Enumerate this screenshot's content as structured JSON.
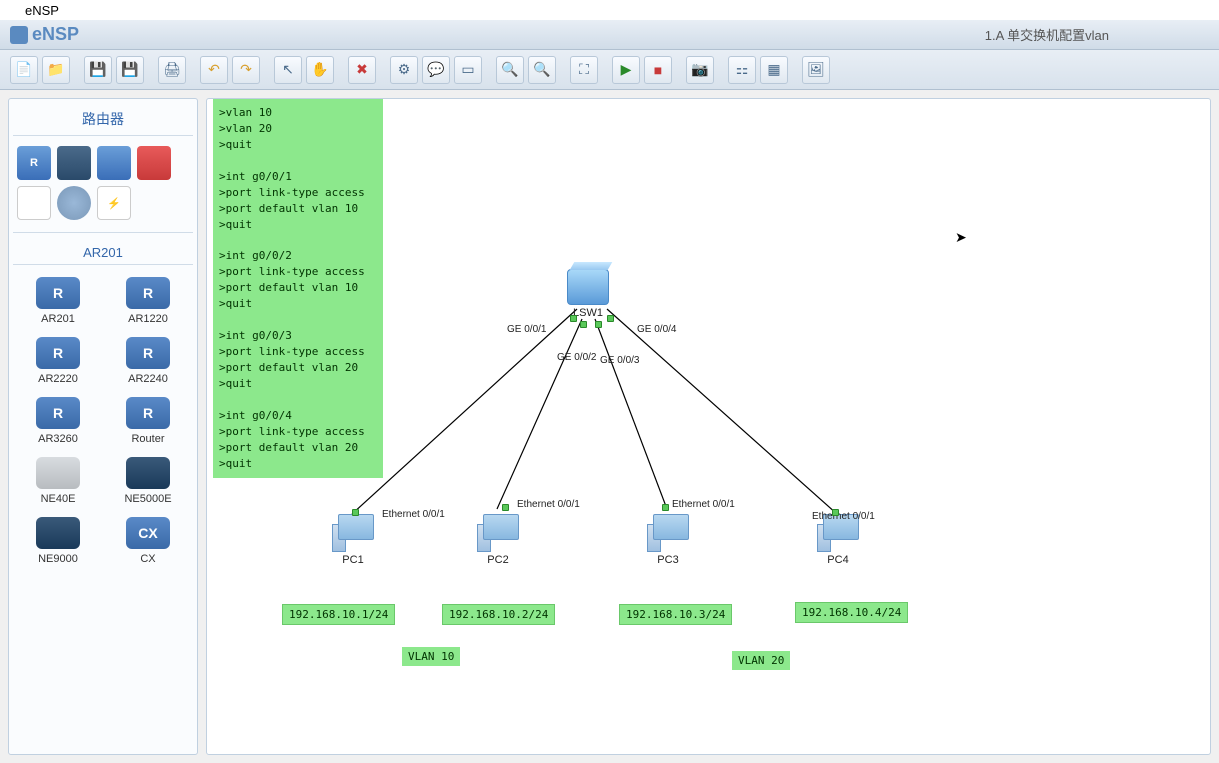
{
  "macbar": {
    "app": "eNSP"
  },
  "titlebar": {
    "app_name": "eNSP",
    "document": "1.A 单交换机配置vlan"
  },
  "toolbar": {
    "icons": [
      "new-topo",
      "open",
      "save",
      "save-all",
      "print",
      "undo",
      "redo",
      "select",
      "pan",
      "delete",
      "config",
      "text",
      "rect",
      "zoom-in",
      "zoom-out",
      "fit",
      "start",
      "stop",
      "capture",
      "arrange",
      "grid",
      "snapshot"
    ]
  },
  "sidebar": {
    "category_title": "路由器",
    "palette": [
      {
        "name": "router",
        "label": "R",
        "cls": "bg-blue"
      },
      {
        "name": "switch",
        "label": "",
        "cls": "bg-dark"
      },
      {
        "name": "wlan",
        "label": "",
        "cls": "bg-blue"
      },
      {
        "name": "firewall",
        "label": "",
        "cls": "bg-red"
      },
      {
        "name": "pc",
        "label": "",
        "cls": "bg-white"
      },
      {
        "name": "cloud",
        "label": "",
        "cls": "bg-cloud"
      },
      {
        "name": "other",
        "label": "⚡",
        "cls": "bg-white"
      }
    ],
    "device_section": "AR201",
    "devices": [
      {
        "name": "AR201",
        "icon": "router-ic",
        "glyph": "R"
      },
      {
        "name": "AR1220",
        "icon": "router-ic",
        "glyph": "R"
      },
      {
        "name": "AR2220",
        "icon": "router-ic",
        "glyph": "R"
      },
      {
        "name": "AR2240",
        "icon": "router-ic",
        "glyph": "R"
      },
      {
        "name": "AR3260",
        "icon": "router-ic",
        "glyph": "R"
      },
      {
        "name": "Router",
        "icon": "router-ic",
        "glyph": "R"
      },
      {
        "name": "NE40E",
        "icon": "ne-ic",
        "glyph": ""
      },
      {
        "name": "NE5000E",
        "icon": "dark-ic",
        "glyph": ""
      },
      {
        "name": "NE9000",
        "icon": "dark-ic",
        "glyph": ""
      },
      {
        "name": "CX",
        "icon": "router-ic",
        "glyph": "CX"
      }
    ]
  },
  "topology": {
    "config_text": ">vlan 10\n>vlan 20\n>quit\n\n>int g0/0/1\n>port link-type access\n>port default vlan 10\n>quit\n\n>int g0/0/2\n>port link-type access\n>port default vlan 10\n>quit\n\n>int g0/0/3\n>port link-type access\n>port default vlan 20\n>quit\n\n>int g0/0/4\n>port link-type access\n>port default vlan 20\n>quit",
    "switch": {
      "name": "LSW1",
      "ports": [
        "GE 0/0/1",
        "GE 0/0/2",
        "GE 0/0/3",
        "GE 0/0/4"
      ]
    },
    "pcs": [
      {
        "name": "PC1",
        "port": "Ethernet 0/0/1",
        "ip": "192.168.10.1/24"
      },
      {
        "name": "PC2",
        "port": "Ethernet 0/0/1",
        "ip": "192.168.10.2/24"
      },
      {
        "name": "PC3",
        "port": "Ethernet 0/0/1",
        "ip": "192.168.10.3/24"
      },
      {
        "name": "PC4",
        "port": "Ethernet 0/0/1",
        "ip": "192.168.10.4/24"
      }
    ],
    "vlans": [
      {
        "label": "VLAN 10"
      },
      {
        "label": "VLAN 20"
      }
    ]
  },
  "toolbar_glyphs": {
    "new-topo": "📄",
    "open": "📁",
    "save": "💾",
    "save-all": "💾",
    "print": "🖨",
    "undo": "↶",
    "redo": "↷",
    "select": "↖",
    "pan": "✋",
    "delete": "✖",
    "config": "⚙",
    "text": "💬",
    "rect": "▭",
    "zoom-in": "🔍",
    "zoom-out": "🔍",
    "fit": "⛶",
    "start": "▶",
    "stop": "■",
    "capture": "📷",
    "arrange": "⚏",
    "grid": "▦",
    "snapshot": "🖼"
  }
}
